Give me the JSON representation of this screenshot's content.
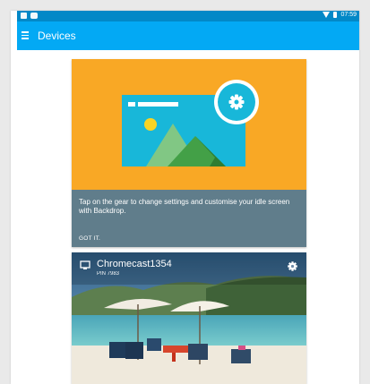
{
  "status_bar": {
    "time": "07:59"
  },
  "app_bar": {
    "title": "Devices"
  },
  "tip_card": {
    "message": "Tap on the gear to change settings and customise your idle screen with Backdrop.",
    "action": "GOT IT."
  },
  "device_card": {
    "name": "Chromecast1354",
    "pin": "PIN 7983"
  },
  "colors": {
    "status_bar": "#0288c7",
    "app_bar": "#03a9f4",
    "tip_art_bg": "#f9a825",
    "tip_bottom_bg": "#607d8b",
    "illustration_blue": "#18b7d9"
  },
  "icons": [
    "menu-icon",
    "gear-icon",
    "cast-icon",
    "wifi-icon",
    "battery-icon"
  ]
}
